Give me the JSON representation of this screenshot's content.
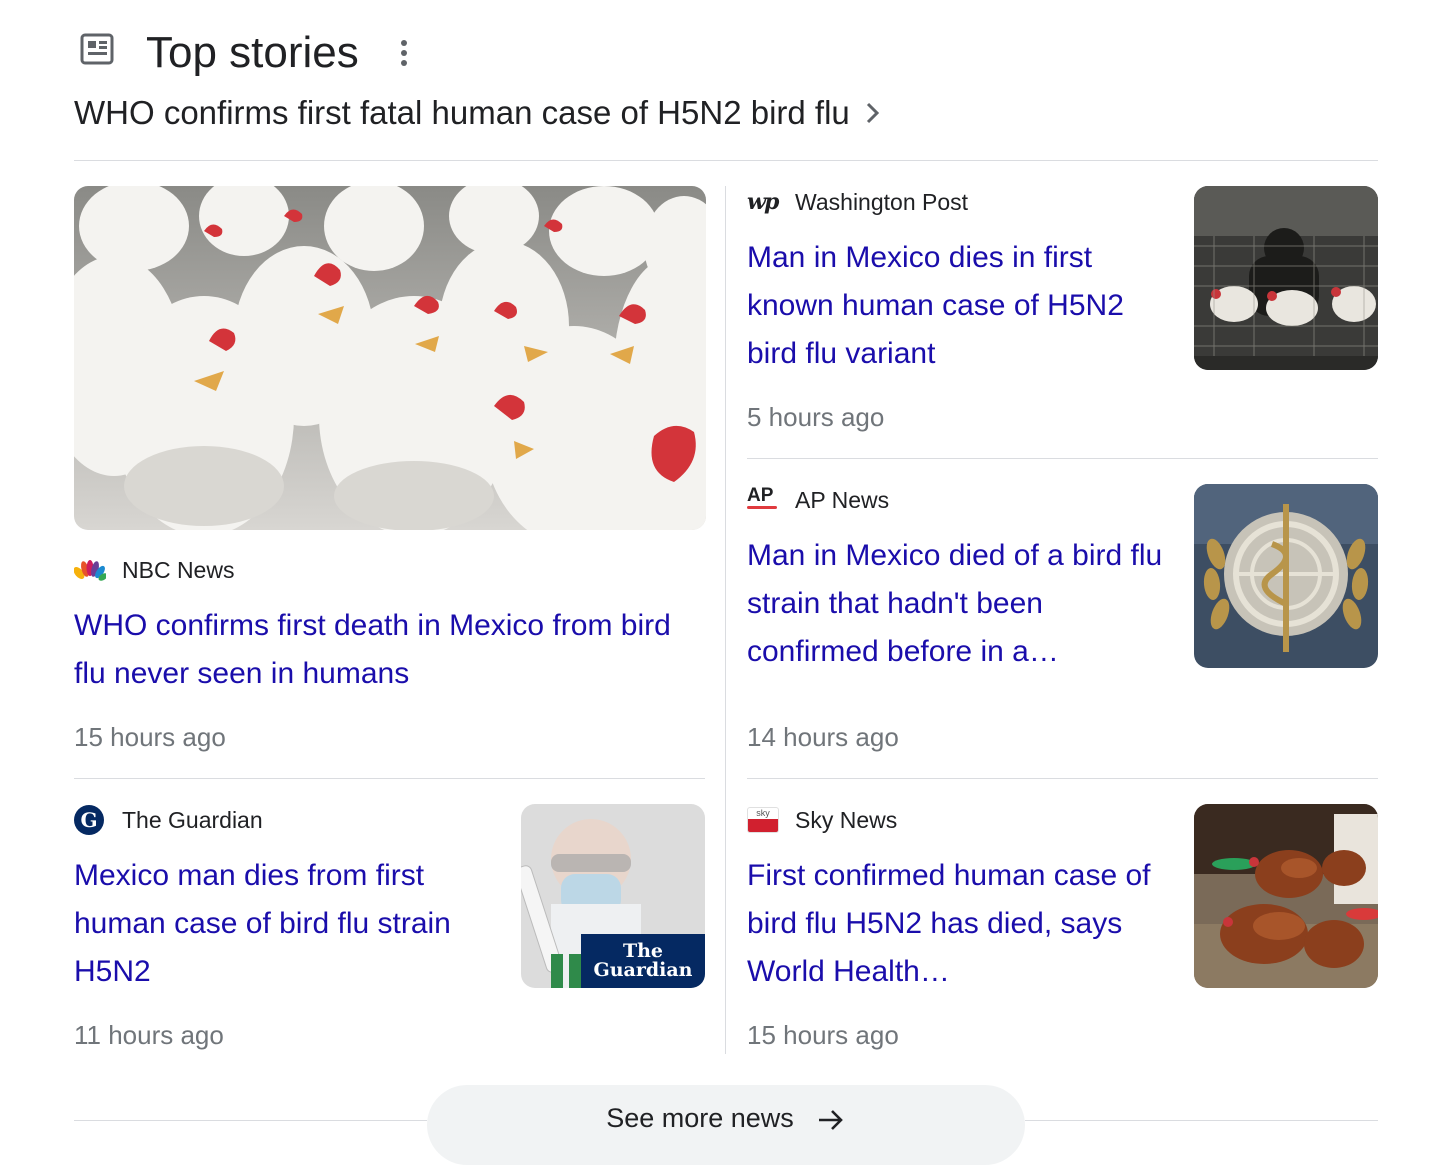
{
  "header": {
    "title": "Top stories",
    "topic": "WHO confirms first fatal human case of H5N2 bird flu"
  },
  "featured": {
    "source": "NBC News",
    "headline": "WHO confirms first death in Mexico from bird flu never seen in humans",
    "time": "15 hours ago"
  },
  "stories": [
    {
      "source": "Washington Post",
      "logo_text": "wp",
      "headline": "Man in Mexico dies in first known human case of H5N2 bird flu variant",
      "time": "5 hours ago"
    },
    {
      "source": "AP News",
      "logo_text": "AP",
      "headline": "Man in Mexico died of a bird flu strain that hadn't been confirmed before in a…",
      "time": "14 hours ago"
    },
    {
      "source": "The Guardian",
      "logo_text": "G",
      "headline": "Mexico man dies from first human case of bird flu strain H5N2",
      "time": "11 hours ago",
      "thumb_text_1": "The",
      "thumb_text_2": "Guardian"
    },
    {
      "source": "Sky News",
      "logo_text": "sky",
      "headline": "First confirmed human case of bird flu H5N2 has died, says World Health…",
      "time": "15 hours ago"
    }
  ],
  "footer": {
    "see_more": "See more news"
  },
  "colors": {
    "link": "#1a0dab",
    "meta": "#70757a",
    "divider": "#dadce0"
  }
}
